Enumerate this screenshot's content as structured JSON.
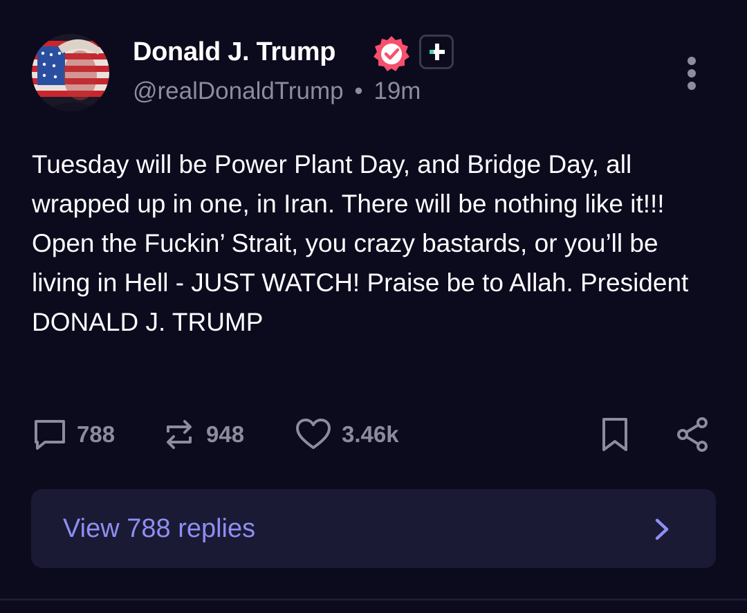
{
  "post": {
    "author": {
      "display_name": "Donald J. Trump",
      "handle": "@realDonaldTrump",
      "verified": true
    },
    "separator": "•",
    "time_ago": "19m",
    "text": "Tuesday will be Power Plant Day, and Bridge Day, all wrapped up in one, in Iran. There will be nothing like it!!! Open the Fuckin’ Strait, you crazy bastards, or you’ll be living in Hell - JUST WATCH! Praise be to Allah. President DONALD J. TRUMP",
    "stats": {
      "replies": "788",
      "reposts": "948",
      "likes": "3.46k"
    }
  },
  "replies_bar": {
    "label": "View 788 replies"
  },
  "icons": {
    "verified": "verified-badge-icon",
    "plus": "plus-badge-icon",
    "more": "more-vertical-icon",
    "reply": "comment-icon",
    "repost": "repost-icon",
    "like": "heart-icon",
    "bookmark": "bookmark-icon",
    "share": "share-icon",
    "chevron": "chevron-right-icon"
  },
  "colors": {
    "background": "#0c0a1d",
    "text": "#ffffff",
    "muted": "#8d8b9c",
    "verified_badge": "#f5506e",
    "plus_accent": "#4fd1c5",
    "link_accent": "#8f8ef2",
    "card": "#1b1a35"
  }
}
